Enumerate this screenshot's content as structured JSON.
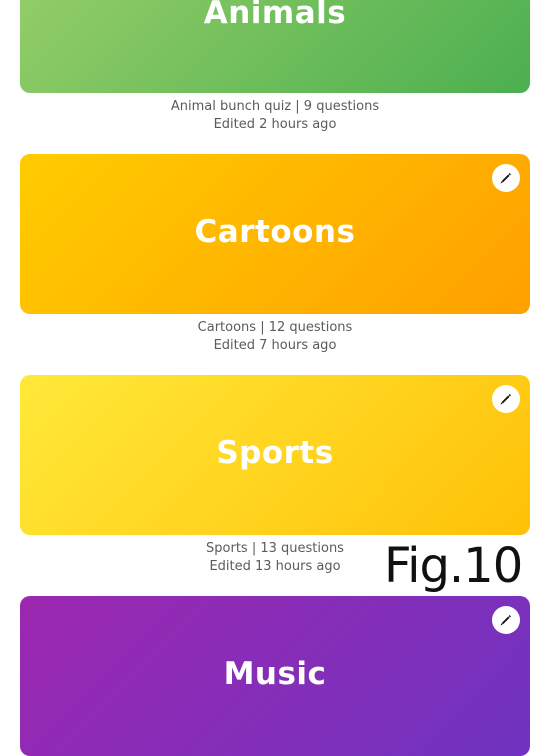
{
  "colors": {
    "animals_gradient": [
      "#9ad06a",
      "#4caf50"
    ],
    "cartoons_gradient": [
      "#ffcc00",
      "#ffa000"
    ],
    "sports_gradient": [
      "#ffe93a",
      "#ffc107"
    ],
    "music_gradient": [
      "#9c27b0",
      "#6f34c0"
    ],
    "meta_text": "#5b5b5b"
  },
  "quizzes": [
    {
      "title": "Animals",
      "description": "Animal bunch quiz | 9 questions",
      "edited": "Edited 2 hours ago",
      "edit_icon": "pencil-icon"
    },
    {
      "title": "Cartoons",
      "description": "Cartoons | 12 questions",
      "edited": "Edited 7 hours ago",
      "edit_icon": "pencil-icon"
    },
    {
      "title": "Sports",
      "description": "Sports | 13 questions",
      "edited": "Edited 13 hours ago",
      "edit_icon": "pencil-icon"
    },
    {
      "title": "Music",
      "edit_icon": "pencil-icon"
    }
  ],
  "figure_label": "Fig.10"
}
